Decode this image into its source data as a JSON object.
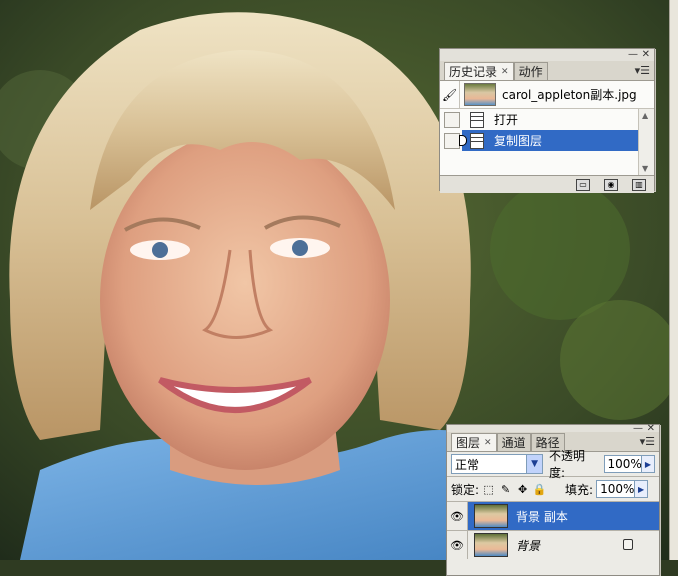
{
  "history_panel": {
    "tabs": [
      {
        "label": "历史记录",
        "active": true
      },
      {
        "label": "动作",
        "active": false
      }
    ],
    "snapshot_name": "carol_appleton副本.jpg",
    "steps": [
      {
        "label": "打开",
        "selected": false
      },
      {
        "label": "复制图层",
        "selected": true
      }
    ]
  },
  "layers_panel": {
    "tabs": [
      {
        "label": "图层",
        "active": true
      },
      {
        "label": "通道",
        "active": false
      },
      {
        "label": "路径",
        "active": false
      }
    ],
    "blend_mode": "正常",
    "opacity_label": "不透明度:",
    "opacity_value": "100%",
    "lock_label": "锁定:",
    "fill_label": "填充:",
    "fill_value": "100%",
    "layers": [
      {
        "name": "背景 副本",
        "selected": true,
        "locked": false
      },
      {
        "name": "背景",
        "selected": false,
        "locked": true
      }
    ]
  },
  "colors": {
    "selection": "#316ac5",
    "panel_bg": "#ecebe6"
  }
}
